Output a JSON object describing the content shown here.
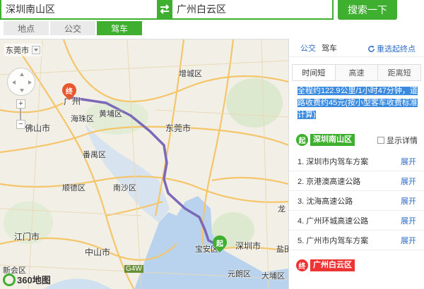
{
  "search": {
    "from_value": "深圳南山区",
    "to_value": "广州白云区",
    "button_label": "搜索一下",
    "accent_color": "#3eaf2f"
  },
  "mode_tabs": [
    {
      "label": "地点",
      "active": false
    },
    {
      "label": "公交",
      "active": false
    },
    {
      "label": "驾车",
      "active": true
    }
  ],
  "map": {
    "city_selector": "东莞市",
    "logo_text": "360地图",
    "route_color": "#7b68b8",
    "places": [
      {
        "label": "增城区"
      },
      {
        "label": "广州"
      },
      {
        "label": "海珠区"
      },
      {
        "label": "黄埔区"
      },
      {
        "label": "佛山市"
      },
      {
        "label": "番禺区"
      },
      {
        "label": "东莞市"
      },
      {
        "label": "顺德区"
      },
      {
        "label": "南沙区"
      },
      {
        "label": "江门市"
      },
      {
        "label": "中山市"
      },
      {
        "label": "宝安区"
      },
      {
        "label": "深圳市"
      },
      {
        "label": "新会区"
      },
      {
        "label": "元朗区"
      },
      {
        "label": "大埔区"
      },
      {
        "label": "盐田"
      },
      {
        "label": "龙"
      },
      {
        "label": "G4W"
      }
    ],
    "markers": {
      "start_label": "起",
      "end_label": "终"
    }
  },
  "panel": {
    "head_tabs": [
      {
        "label": "公交",
        "active": true
      },
      {
        "label": "驾车",
        "active": false
      }
    ],
    "reselect_label": "重选起终点",
    "route_tabs": [
      {
        "label": "时间短",
        "active": true
      },
      {
        "label": "高速",
        "active": false
      },
      {
        "label": "距离短",
        "active": false
      }
    ],
    "summary": "全程约122.9公里/1小时47分钟，道路收费约45元(按小型客车收费标准计算)",
    "start": {
      "badge": "起",
      "name": "深圳南山区"
    },
    "detail_toggle": "显示详情",
    "steps": [
      {
        "text": "1. 深圳市内驾车方案",
        "action": "展开"
      },
      {
        "text": "2. 京港澳高速公路",
        "action": "展开"
      },
      {
        "text": "3. 沈海高速公路",
        "action": "展开"
      },
      {
        "text": "4. 广州环城高速公路",
        "action": "展开"
      },
      {
        "text": "5. 广州市内驾车方案",
        "action": "展开"
      }
    ],
    "end": {
      "badge": "终",
      "name": "广州白云区"
    }
  }
}
